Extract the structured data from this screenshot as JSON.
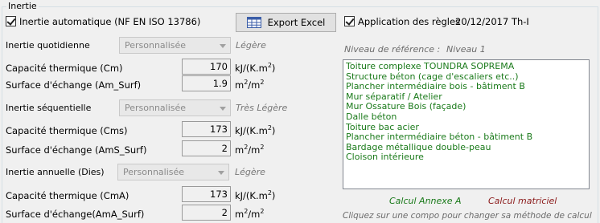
{
  "group": {
    "title": "Inertie"
  },
  "header": {
    "inertie_auto_label": "Inertie automatique (NF EN ISO 13786)",
    "export_label": "Export Excel",
    "application_label": "Application des règles",
    "application_date": "20/12/2017 Th-I"
  },
  "reference": {
    "label": "Niveau de référence :",
    "value": "Niveau 1"
  },
  "quotidienne": {
    "label": "Inertie quotidienne",
    "select": "Personnalisée",
    "level": "Légère",
    "cap_label": "Capacité thermique (Cm)",
    "cap_value": "170",
    "cap_unit_base": "kJ/(K.m",
    "cap_unit_sup": "2",
    "cap_unit_end": ")",
    "surf_label": "Surface d'échange (Am_Surf)",
    "surf_value": "1.9",
    "surf_unit_base": "m",
    "surf_unit_sup": "2",
    "surf_unit_mid": "/m",
    "surf_unit_sup2": "2"
  },
  "sequentielle": {
    "label": "Inertie séquentielle",
    "select": "Personnalisée",
    "level": "Très Légère",
    "cap_label": "Capacité thermique (Cms)",
    "cap_value": "173",
    "cap_unit_base": "kJ/(K.m",
    "cap_unit_sup": "2",
    "cap_unit_end": ")",
    "surf_label": "Surface d'échange (AmS_Surf)",
    "surf_value": "2",
    "surf_unit_base": "m",
    "surf_unit_sup": "2",
    "surf_unit_mid": "/m",
    "surf_unit_sup2": "2"
  },
  "annuelle": {
    "label": "Inertie annuelle (Dies)",
    "select": "Personnalisée",
    "level": "Légère",
    "cap_label": "Capacité thermique (CmA)",
    "cap_value": "173",
    "cap_unit_base": "kJ/(K.m",
    "cap_unit_sup": "2",
    "cap_unit_end": ")",
    "surf_label": "Surface d'échange(AmA_Surf)",
    "surf_value": "2",
    "surf_unit_base": "m",
    "surf_unit_sup": "2",
    "surf_unit_mid": "/m",
    "surf_unit_sup2": "2"
  },
  "compositions": [
    "Toiture complexe TOUNDRA SOPREMA",
    "Structure béton (cage d'escaliers etc..)",
    "Plancher intermédiaire bois - bâtiment B",
    "Mur séparatif / Atelier",
    "Mur Ossature Bois (façade)",
    "Dalle béton",
    "Toiture bac acier",
    "Plancher intermédiaire béton - bâtiment B",
    "Bardage métallique double-peau",
    "Cloison intérieure"
  ],
  "footer": {
    "calcul_annexe": "Calcul Annexe A",
    "calcul_matriciel": "Calcul matriciel",
    "hint": "Cliquez sur une compo pour changer sa méthode de calcul"
  },
  "colors": {
    "annexe": "#1a7a1a",
    "matriciel": "#8b1a1a",
    "list_text": "#1a7a1a"
  }
}
